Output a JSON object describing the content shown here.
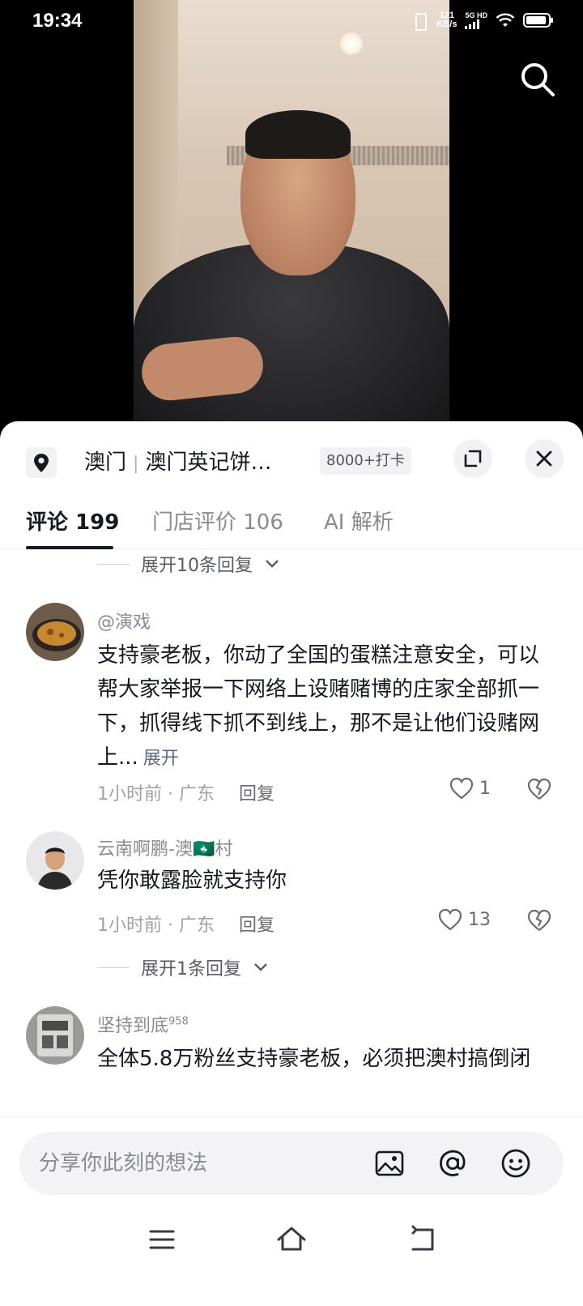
{
  "status_bar": {
    "time": "19:34",
    "speed_value": "121",
    "speed_unit": "KB/s",
    "network": "5G HD"
  },
  "location": {
    "city": "澳门",
    "place": "澳门英记饼…",
    "checkins": "8000+打卡"
  },
  "tabs": [
    {
      "label": "评论 199"
    },
    {
      "label": "门店评价 106"
    },
    {
      "label": "AI 解析"
    }
  ],
  "expand_top": "展开10条回复",
  "comments": [
    {
      "user": "@演戏",
      "text": "支持豪老板，你动了全国的蛋糕注意安全，可以帮大家举报一下网络上设赌赌博的庄家全部抓一下，抓得线下抓不到线上，那不是让他们设赌网上...",
      "more": "展开",
      "time": "1小时前 · 广东",
      "reply": "回复",
      "likes": "1"
    },
    {
      "user": "云南啊鹏-澳🇲🇴村",
      "text": "凭你敢露脸就支持你",
      "time": "1小时前 · 广东",
      "reply": "回复",
      "likes": "13",
      "expand": "展开1条回复"
    },
    {
      "user": "坚持到底",
      "user_sup": "958",
      "text": "全体5.8万粉丝支持豪老板，必须把澳村搞倒闭"
    }
  ],
  "input": {
    "placeholder": "分享你此刻的想法"
  },
  "icons": {
    "search": "search-icon",
    "location": "location-pin-icon",
    "expand": "expand-icon",
    "close": "close-icon",
    "image": "image-icon",
    "mention": "at-icon",
    "emoji": "emoji-icon",
    "like": "heart-icon",
    "dislike": "broken-heart-icon"
  }
}
